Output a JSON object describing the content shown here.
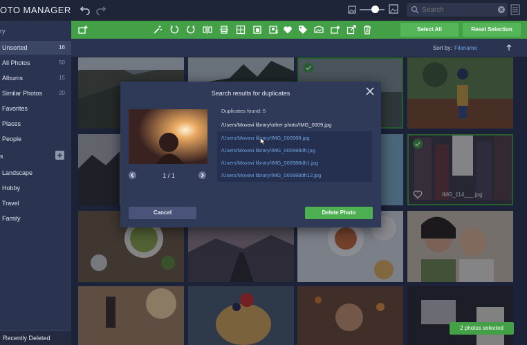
{
  "window": {
    "title": "OTO MANAGER"
  },
  "search": {
    "placeholder": "Search",
    "value": ""
  },
  "sidebar": {
    "top_label": "ry",
    "items": [
      {
        "label": "Unsorted",
        "count": "16"
      },
      {
        "label": "All Photos",
        "count": "50"
      },
      {
        "label": "Albums",
        "count": "15"
      },
      {
        "label": "Similar Photos",
        "count": "20"
      },
      {
        "label": "Favorites",
        "count": ""
      },
      {
        "label": "Places",
        "count": ""
      },
      {
        "label": "People",
        "count": ""
      }
    ],
    "albums_section_label": "s",
    "albums": [
      {
        "label": "Landscape"
      },
      {
        "label": "Hobby"
      },
      {
        "label": "Travel"
      },
      {
        "label": "Family"
      }
    ],
    "recently_deleted": "Recently Deleted"
  },
  "toolbar": {
    "icons": [
      "import-icon",
      "magic-wand-icon",
      "rotate-left-icon",
      "rotate-right-icon",
      "flip-icon",
      "straighten-icon",
      "crop-icon",
      "resize-icon",
      "background-remove-icon",
      "heart-icon",
      "tag-icon",
      "collage-icon",
      "add-to-album-icon",
      "share-icon",
      "trash-icon"
    ],
    "select_all": "Select All",
    "reset_selection": "Reset Selection"
  },
  "sort": {
    "label": "Sort by:",
    "value": "Filename"
  },
  "grid": {
    "selected_tile_name": "IMG_114___.jpg"
  },
  "modal": {
    "title": "Search results for duplicates",
    "duplicates_found": "Duplicates found: 5",
    "page_indicator": "1 / 1",
    "main_file": "/Users/Movavi library/other photo/IMG_0009.jpg",
    "duplicates": [
      "/Users/Movavi library/IMG_000988.jpg",
      "/Users/Movavi library/IMG_000988dh.jpg",
      "/Users/Movavi library/IMG_000988dh1.jpg",
      "/Users/Movavi library/IMG_000988dh12.jpg"
    ],
    "cancel": "Cancel",
    "delete": "Delete Photo"
  },
  "status": {
    "selected_count": "2 photos selected"
  },
  "colors": {
    "accent_green": "#43a047",
    "link_blue": "#6fa3df",
    "sidebar_bg": "#2a3350"
  }
}
